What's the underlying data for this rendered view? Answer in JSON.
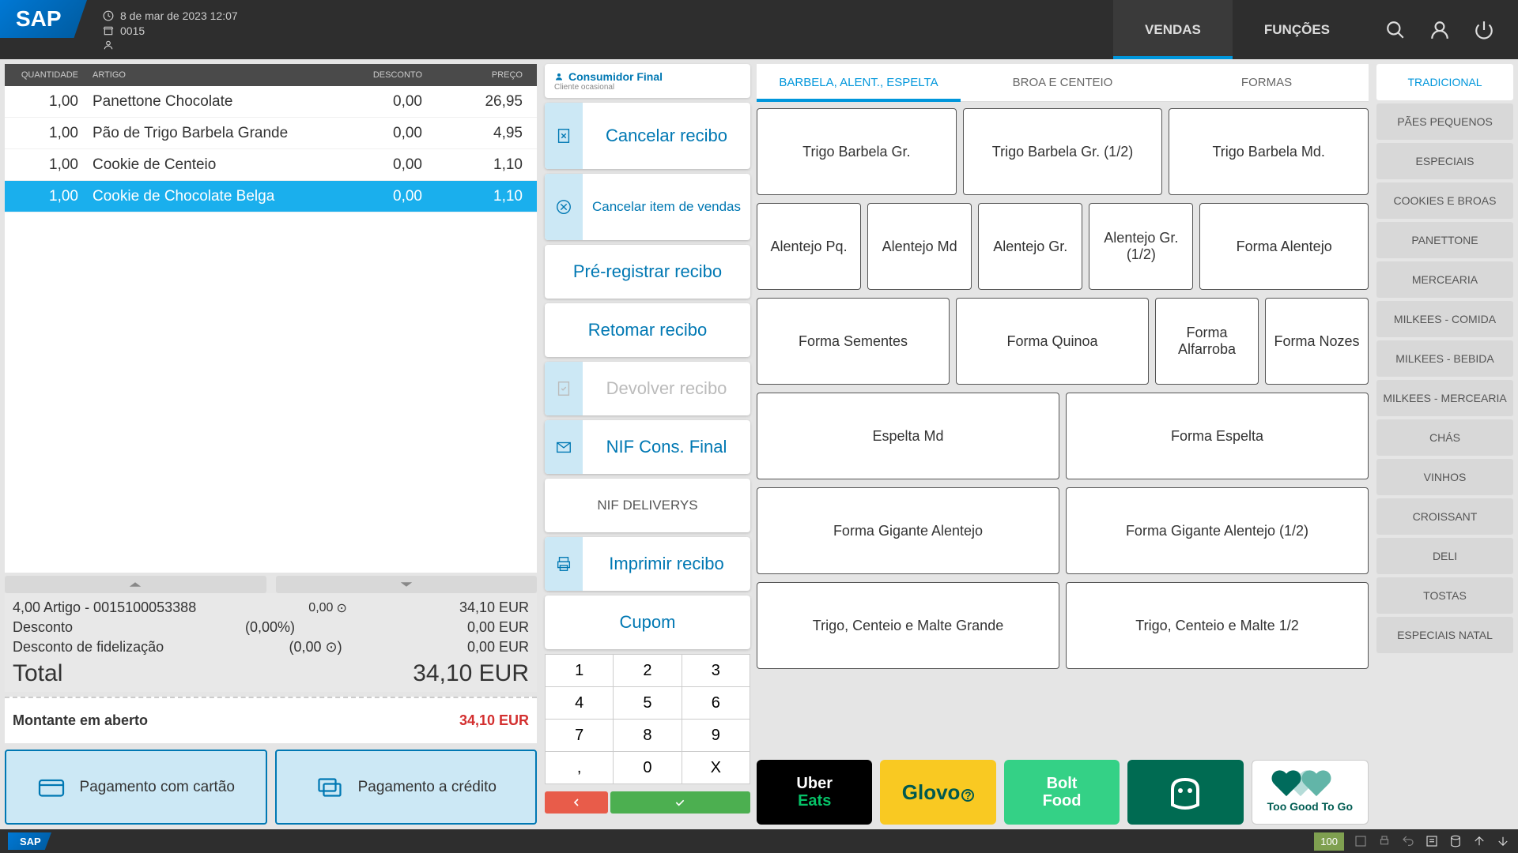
{
  "header": {
    "logo": "SAP",
    "datetime": "8 de mar de 2023 12:07",
    "store": "0015",
    "user": "",
    "tabs": {
      "vendas": "VENDAS",
      "funcoes": "FUNÇÕES"
    }
  },
  "receipt": {
    "headers": {
      "qty": "Quantidade",
      "art": "Artigo",
      "disc": "Desconto",
      "price": "Preço"
    },
    "lines": [
      {
        "qty": "1,00",
        "art": "Panettone Chocolate",
        "disc": "0,00",
        "price": "26,95",
        "selected": false
      },
      {
        "qty": "1,00",
        "art": "Pão de Trigo Barbela Grande",
        "disc": "0,00",
        "price": "4,95",
        "selected": false
      },
      {
        "qty": "1,00",
        "art": "Cookie de Centeio",
        "disc": "0,00",
        "price": "1,10",
        "selected": false
      },
      {
        "qty": "1,00",
        "art": "Cookie de Chocolate Belga",
        "disc": "0,00",
        "price": "1,10",
        "selected": true
      }
    ],
    "summary": {
      "items_line": "4,00 Artigo - 0015100053388",
      "items_disc": "0,00",
      "items_total": "34,10 EUR",
      "discount_label": "Desconto",
      "discount_pct": "(0,00%)",
      "discount_val": "0,00 EUR",
      "fidel_label": "Desconto de fidelização",
      "fidel_amt": "(0,00 ⊙)",
      "fidel_val": "0,00 EUR",
      "total_label": "Total",
      "total_val": "34,10 EUR"
    },
    "open": {
      "label": "Montante em aberto",
      "val": "34,10 EUR"
    },
    "pay": {
      "card": "Pagamento com cartão",
      "credit": "Pagamento a crédito"
    }
  },
  "customer": {
    "name": "Consumidor Final",
    "sub": "Cliente ocasional"
  },
  "actions": {
    "cancel_receipt": "Cancelar recibo",
    "cancel_item": "Cancelar item de vendas",
    "preregister": "Pré-registrar recibo",
    "resume": "Retomar recibo",
    "return": "Devolver recibo",
    "nif_final": "NIF Cons. Final",
    "nif_delivery": "NIF DELIVERYS",
    "print": "Imprimir recibo",
    "coupon": "Cupom"
  },
  "keypad": [
    "1",
    "2",
    "3",
    "4",
    "5",
    "6",
    "7",
    "8",
    "9",
    ",",
    "0",
    "X"
  ],
  "product_tabs": [
    "BARBELA, ALENT., ESPELTA",
    "BROA E CENTEIO",
    "FORMAS"
  ],
  "products_r1": [
    "Trigo Barbela Gr.",
    "Trigo Barbela Gr. (1/2)",
    "Trigo Barbela Md."
  ],
  "products_r2": [
    "Alentejo Pq.",
    "Alentejo Md",
    "Alentejo Gr.",
    "Alentejo Gr. (1/2)",
    "Forma Alentejo"
  ],
  "products_r3": [
    "Forma Sementes",
    "Forma Quinoa",
    "Forma Alfarroba",
    "Forma Nozes"
  ],
  "products_r4": [
    "Espelta Md",
    "Forma Espelta"
  ],
  "products_r5": [
    "Forma Gigante Alentejo",
    "Forma Gigante Alentejo (1/2)"
  ],
  "products_r6": [
    "Trigo, Centeio e Malte Grande",
    "Trigo, Centeio e Malte 1/2"
  ],
  "delivery": {
    "uber1": "Uber",
    "uber2": "Eats",
    "glovo": "Glovo",
    "bolt1": "Bolt",
    "bolt2": "Food",
    "tgtg": "Too Good To Go"
  },
  "categories": [
    "TRADICIONAL",
    "PÃES PEQUENOS",
    "ESPECIAIS",
    "COOKIES E BROAS",
    "PANETTONE",
    "MERCEARIA",
    "MILKEES - COMIDA",
    "MILKEES - BEBIDA",
    "MILKEES - MERCEARIA",
    "CHÁS",
    "VINHOS",
    "CROISSANT",
    "DELI",
    "TOSTAS",
    "ESPECIAIS NATAL"
  ],
  "footer": {
    "zoom": "100"
  }
}
